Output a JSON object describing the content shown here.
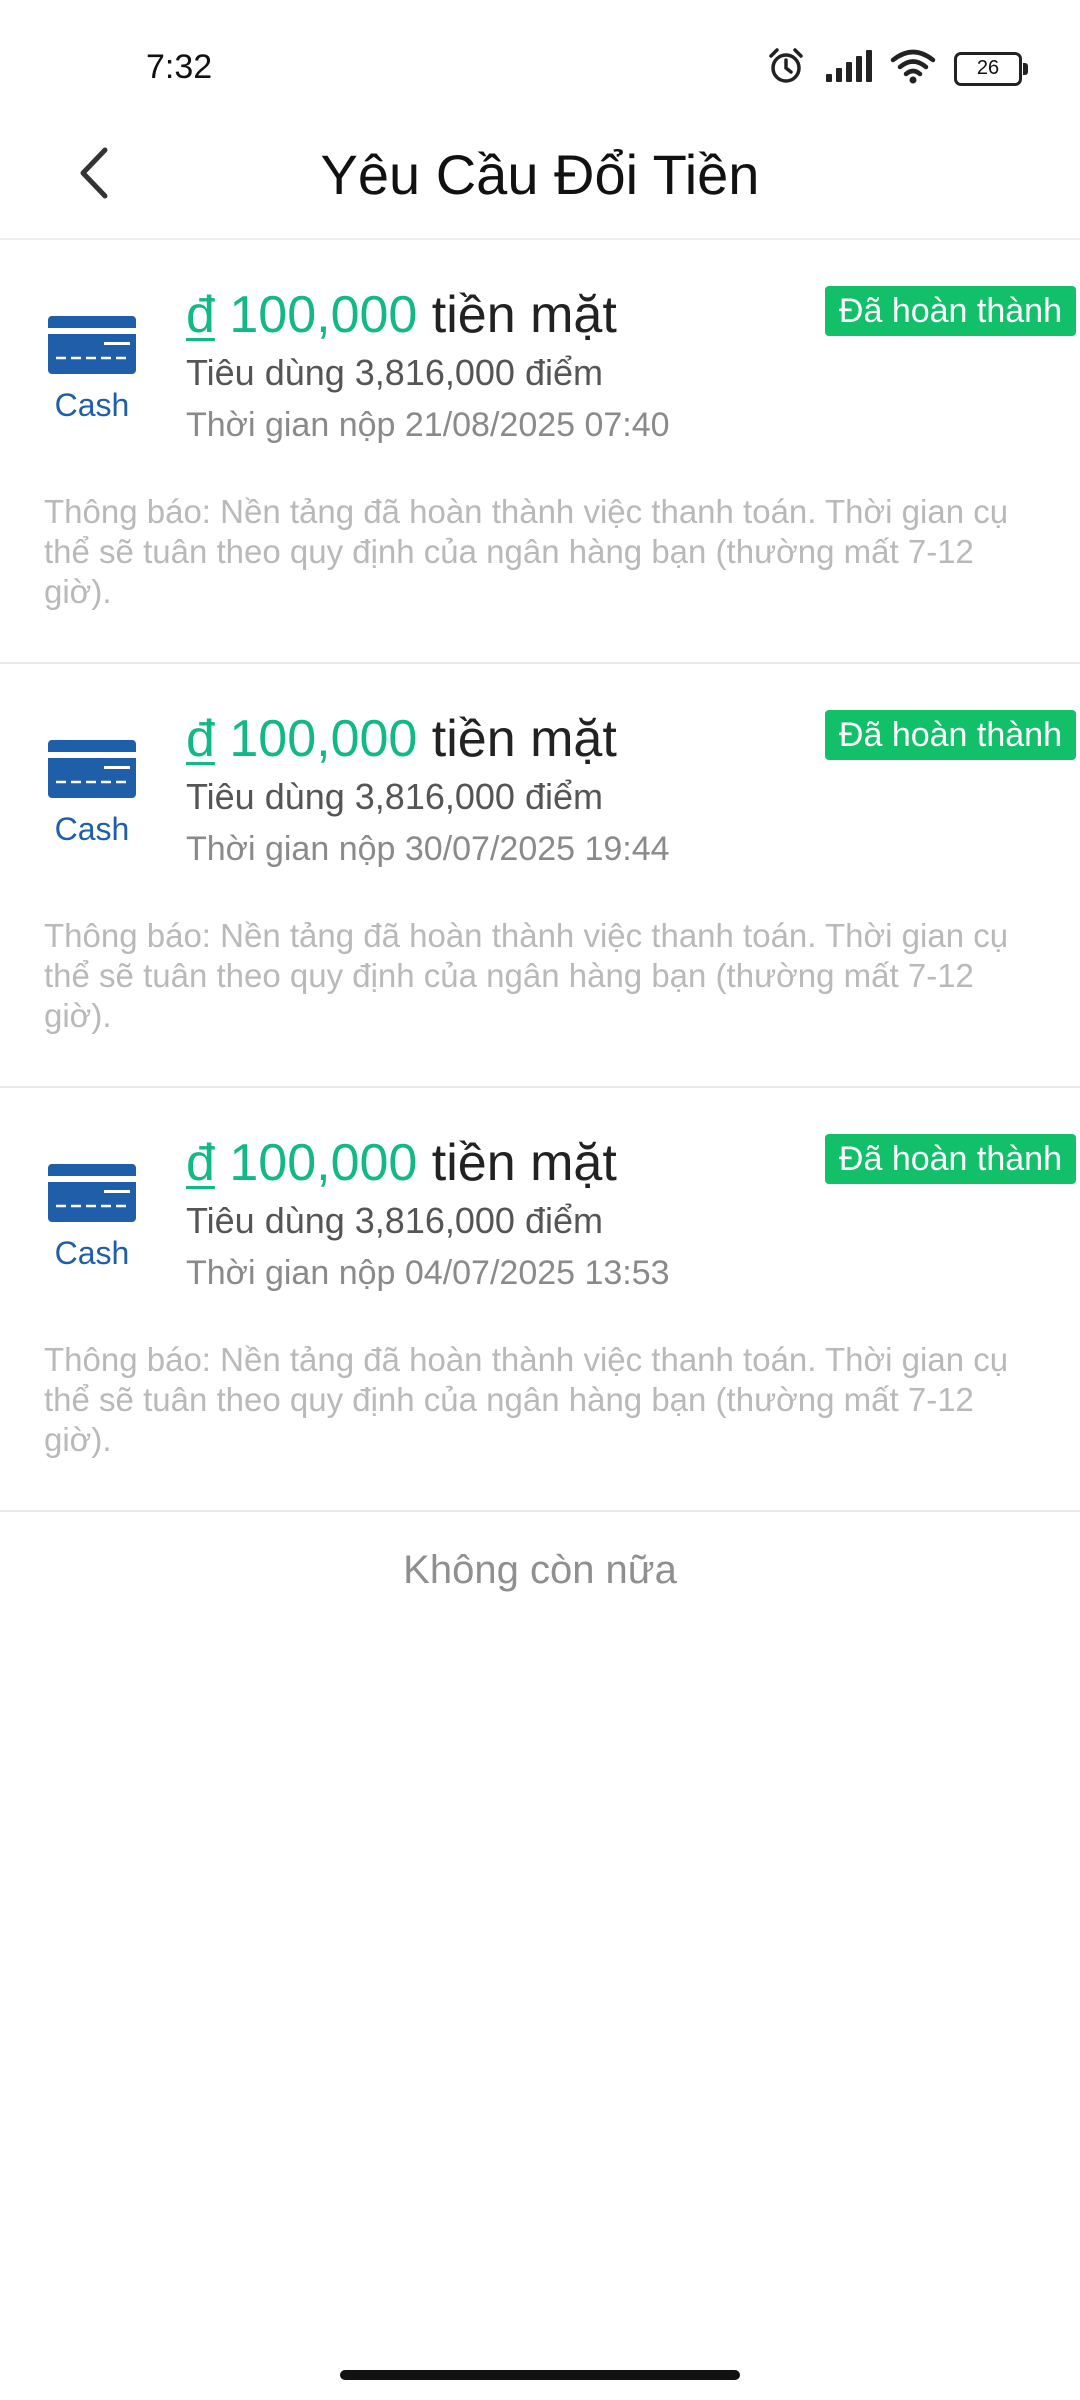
{
  "status_bar": {
    "time": "7:32",
    "battery": "26",
    "icons": [
      "alarm-icon",
      "signal-icon",
      "wifi-icon",
      "battery-icon"
    ]
  },
  "header": {
    "title": "Yêu Cầu Đổi Tiền",
    "back_icon": "chevron-left-icon"
  },
  "records": [
    {
      "icon": "cash-card-icon",
      "icon_label": "Cash",
      "currency": "đ",
      "amount": "100,000",
      "type": "tiền mặt",
      "status": "Đã hoàn thành",
      "points": "Tiêu dùng 3,816,000 điểm",
      "time": "Thời gian nộp 21/08/2025 07:40",
      "notice": "Thông báo: Nền tảng đã hoàn thành việc thanh toán. Thời gian cụ thể sẽ tuân theo quy định của ngân hàng bạn (thường mất 7-12 giờ)."
    },
    {
      "icon": "cash-card-icon",
      "icon_label": "Cash",
      "currency": "đ",
      "amount": "100,000",
      "type": "tiền mặt",
      "status": "Đã hoàn thành",
      "points": "Tiêu dùng 3,816,000 điểm",
      "time": "Thời gian nộp 30/07/2025 19:44",
      "notice": "Thông báo: Nền tảng đã hoàn thành việc thanh toán. Thời gian cụ thể sẽ tuân theo quy định của ngân hàng bạn (thường mất 7-12 giờ)."
    },
    {
      "icon": "cash-card-icon",
      "icon_label": "Cash",
      "currency": "đ",
      "amount": "100,000",
      "type": "tiền mặt",
      "status": "Đã hoàn thành",
      "points": "Tiêu dùng 3,816,000 điểm",
      "time": "Thời gian nộp 04/07/2025 13:53",
      "notice": "Thông báo: Nền tảng đã hoàn thành việc thanh toán. Thời gian cụ thể sẽ tuân theo quy định của ngân hàng bạn (thường mất 7-12 giờ)."
    }
  ],
  "footer": {
    "no_more": "Không còn nữa"
  },
  "colors": {
    "accent_green": "#12b886",
    "badge_green": "#12c06a",
    "cash_blue": "#1f5faa"
  }
}
